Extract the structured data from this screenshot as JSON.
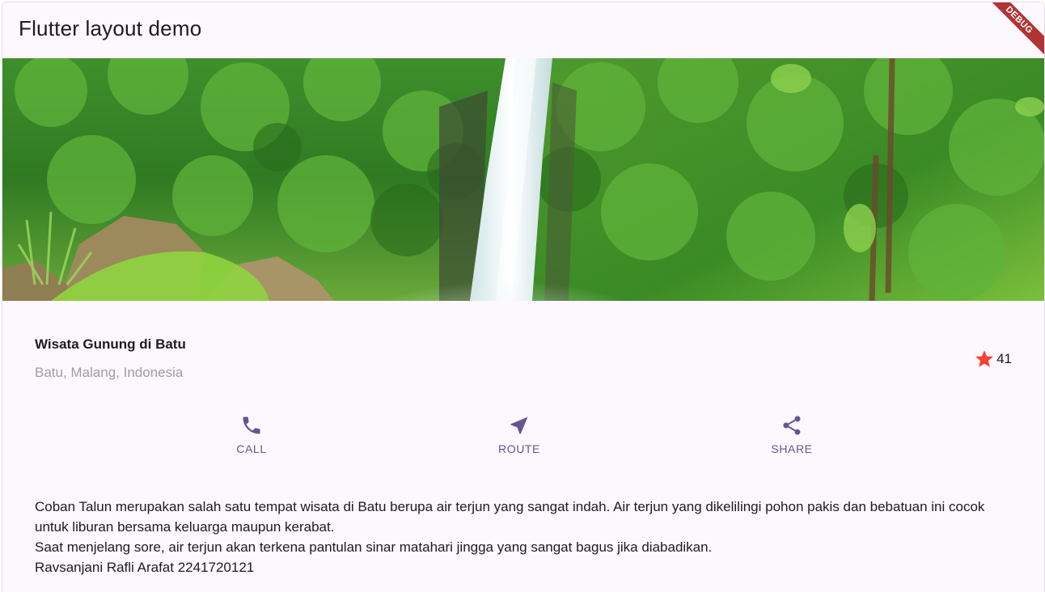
{
  "appbar": {
    "title": "Flutter layout demo",
    "debug_label": "DEBUG"
  },
  "hero_image": {
    "alt": "Coban Talun waterfall surrounded by green ferns and rocks"
  },
  "place": {
    "name": "Wisata Gunung di Batu",
    "location": "Batu, Malang, Indonesia",
    "rating_count": "41",
    "star_icon": "star-icon"
  },
  "buttons": [
    {
      "label": "CALL",
      "icon": "phone-icon"
    },
    {
      "label": "ROUTE",
      "icon": "navigation-icon"
    },
    {
      "label": "SHARE",
      "icon": "share-icon"
    }
  ],
  "description": {
    "line1": "Coban Talun merupakan salah satu tempat wisata di Batu berupa air terjun yang sangat indah. Air terjun yang dikelilingi pohon pakis dan bebatuan ini cocok untuk liburan bersama keluarga maupun kerabat.",
    "line2": "Saat menjelang sore, air terjun akan terkena pantulan sinar matahari jingga yang sangat bagus jika diabadikan.",
    "line3": "Ravsanjani Rafli Arafat 2241720121"
  },
  "colors": {
    "accent": "#65558f",
    "star": "#f44336",
    "background": "#fdf7fe",
    "debug_banner": "#b13434"
  }
}
